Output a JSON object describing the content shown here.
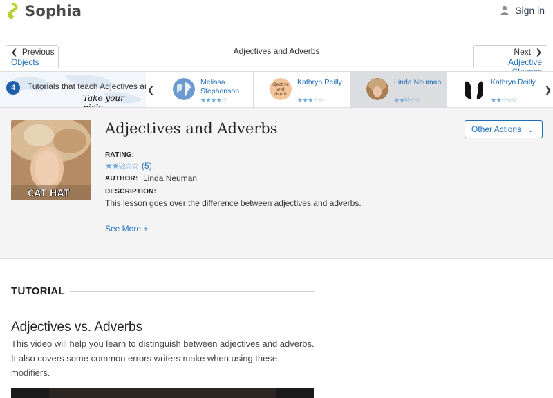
{
  "header": {
    "brand": "Sophia",
    "signin_label": "Sign in",
    "brand_color": "#b8d433"
  },
  "nav": {
    "prev_label": "Previous",
    "prev_target": "Objects",
    "title": "Adjectives and Adverbs",
    "next_label": "Next",
    "next_target": "Adjective Clauses"
  },
  "strip": {
    "count": "4",
    "label": "Tutorials that teach Adjectives and Adverbs",
    "pick": "Take your pick:",
    "tutorials": [
      {
        "author_line1": "Melissa",
        "author_line2": "Stephenson",
        "stars": "★★★★☆",
        "thumb": "globe-thumbnail"
      },
      {
        "author_line1": "Kathryn Reilly",
        "author_line2": "",
        "stars": "★★★☆☆",
        "thumb": "adjective-and-adverb-text-thumbnail",
        "thumb_text_1": "djective",
        "thumb_text_2": "and",
        "thumb_text_3": "dverb"
      },
      {
        "author_line1": "Linda Neuman",
        "author_line2": "",
        "stars": "★★½☆☆",
        "thumb": "cat-hat-thumbnail",
        "active": true
      },
      {
        "author_line1": "Kathryn Reilly",
        "author_line2": "",
        "stars": "★★☆☆☆",
        "thumb": "silhouette-thumbnail"
      }
    ]
  },
  "lesson": {
    "title": "Adjectives and Adverbs",
    "other_actions": "Other Actions",
    "image_caption": "CAT HAT",
    "rating_label": "RATING:",
    "rating_stars": "★★½☆☆",
    "rating_value": 2.5,
    "rating_count": "(5)",
    "author_label": "AUTHOR:",
    "author": "Linda Neuman",
    "description_label": "DESCRIPTION:",
    "description": "This lesson goes over the difference between adjectives and adverbs.",
    "see_more": "See More +"
  },
  "tutorial": {
    "heading": "TUTORIAL",
    "video_title": "Adjectives vs. Adverbs",
    "video_description": "This video will help you learn to distinguish between adjectives and adverbs. It also covers some common errors writers make when using these modifiers."
  },
  "colors": {
    "link": "#1f6fb8",
    "badge": "#1f5ea8",
    "star": "#6fa8d6",
    "panel_bg": "#f4f4f4"
  }
}
